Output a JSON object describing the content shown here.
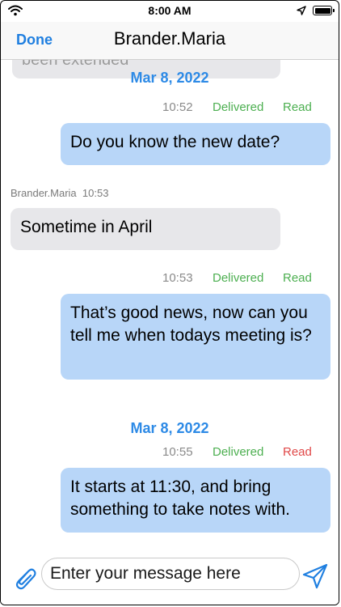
{
  "status_bar": {
    "time": "8:00 AM"
  },
  "nav": {
    "done_label": "Done",
    "title": "Brander.Maria"
  },
  "partial_message": "been extended",
  "messages": [
    {
      "date": "Mar 8, 2022"
    },
    {
      "time": "10:52",
      "delivered": "Delivered",
      "read": "Read",
      "text": "Do you know the new date?"
    },
    {
      "sender": "Brander.Maria",
      "time": "10:53",
      "text": "Sometime in April"
    },
    {
      "time": "10:53",
      "delivered": "Delivered",
      "read": "Read",
      "text": "That’s good news, now can you tell me when todays meeting is?"
    },
    {
      "date": "Mar 8, 2022"
    },
    {
      "time": "10:55",
      "delivered": "Delivered",
      "read": "Read",
      "text": "It starts at 11:30, and bring something to take notes with."
    }
  ],
  "input": {
    "placeholder": "Enter your message here"
  },
  "colors": {
    "accent": "#1f7fe0",
    "outgoing_bubble": "#b8d6f8",
    "incoming_bubble": "#e7e7ea",
    "delivered": "#4caf50",
    "read_unread": "#e04848"
  },
  "icons": {
    "attach": "paperclip-icon",
    "send": "send-icon"
  }
}
